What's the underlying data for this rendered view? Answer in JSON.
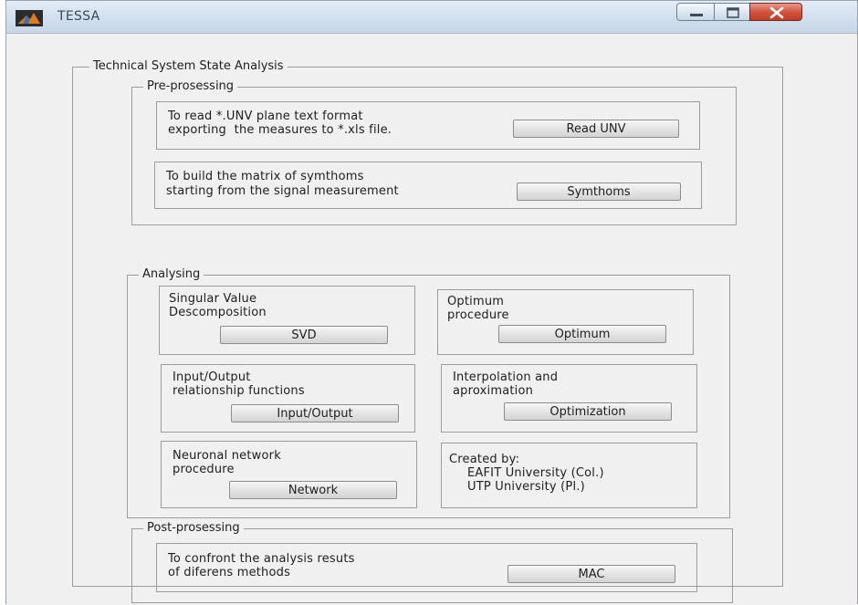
{
  "window": {
    "title": "TESSA",
    "controls": {
      "minimize": "minimize-icon",
      "maximize": "maximize-icon",
      "close": "close-icon"
    }
  },
  "main": {
    "title": "Technical System State Analysis",
    "preprocessing": {
      "title": "Pre-prosessing",
      "read_unv": {
        "line1": "To read *.UNV plane text format",
        "line2": "exporting  the measures to *.xls file.",
        "button": "Read UNV"
      },
      "symthoms": {
        "line1": "To build the matrix of symthoms",
        "line2": "starting from the signal measurement",
        "button": "Symthoms"
      }
    },
    "analysing": {
      "title": "Analysing",
      "svd": {
        "line1": "Singular Value",
        "line2": "Descomposition",
        "button": "SVD"
      },
      "optimum": {
        "line1": "Optimum",
        "line2": "procedure",
        "button": "Optimum"
      },
      "io": {
        "line1": "Input/Output",
        "line2": "relationship functions",
        "button": "Input/Output"
      },
      "interp": {
        "line1": "Interpolation and",
        "line2": "aproximation",
        "button": "Optimization"
      },
      "network": {
        "line1": "Neuronal network",
        "line2": "procedure",
        "button": "Network"
      },
      "credits": {
        "line1": "Created by:",
        "line2": "EAFIT University (Col.)",
        "line3": "UTP University (Pl.)"
      }
    },
    "postprocessing": {
      "title": "Post-prosessing",
      "mac": {
        "line1": "To confront the analysis resuts",
        "line2": "of diferens methods",
        "button": "MAC"
      }
    }
  }
}
